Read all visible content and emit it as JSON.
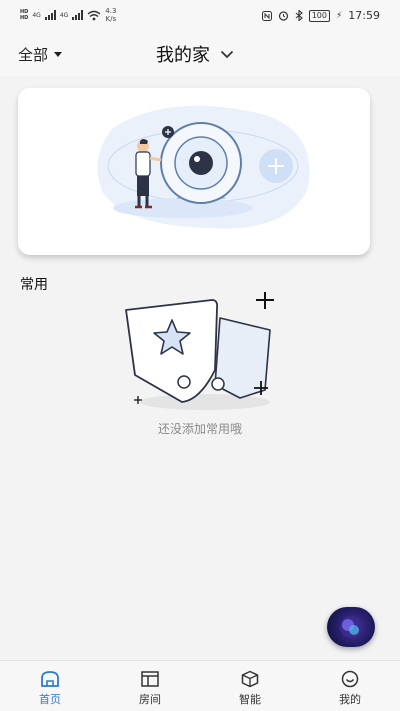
{
  "status_bar": {
    "sim1": "HD",
    "sim2": "HD",
    "net1": "4G",
    "net2": "4G",
    "speed_value": "4.3",
    "speed_unit": "K/s",
    "battery": "100",
    "time": "17:59"
  },
  "header": {
    "scope_label": "全部",
    "home_title": "我的家"
  },
  "section": {
    "title": "常用",
    "empty_text": "还没添加常用哦"
  },
  "tabs": [
    {
      "label": "首页",
      "icon": "home-icon",
      "active": true
    },
    {
      "label": "房间",
      "icon": "room-icon",
      "active": false
    },
    {
      "label": "智能",
      "icon": "smart-cube-icon",
      "active": false
    },
    {
      "label": "我的",
      "icon": "profile-icon",
      "active": false
    }
  ],
  "colors": {
    "accent": "#2a7bd6",
    "background": "#f3f3f3",
    "assistant_orb": "#2b1f78"
  }
}
